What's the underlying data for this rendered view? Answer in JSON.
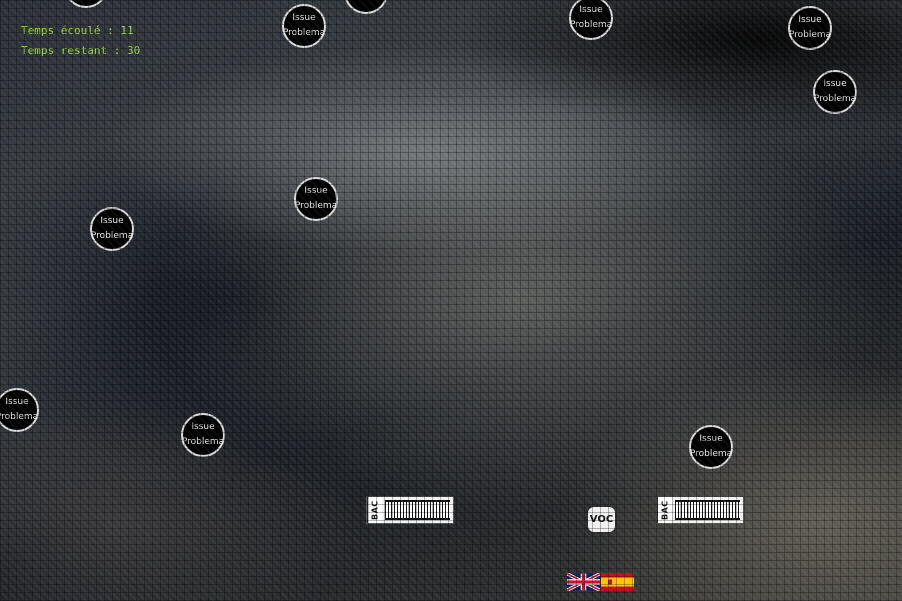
{
  "hud": {
    "elapsed": "Temps écoulé : 11",
    "remaining": "Temps restant : 30"
  },
  "bubbles": [
    {
      "line1": "Issue",
      "line2": "Problema"
    },
    {
      "line1": "Issue",
      "line2": "Problema"
    },
    {
      "line1": "Issue",
      "line2": "Problema"
    },
    {
      "line1": "Issue",
      "line2": "Problema"
    },
    {
      "line1": "Issue",
      "line2": "Problema"
    },
    {
      "line1": "Issue",
      "line2": "Problema"
    },
    {
      "line1": "Issue",
      "line2": "Problema"
    },
    {
      "line1": "Issue",
      "line2": "Problema"
    },
    {
      "line1": "Issue",
      "line2": "Problema"
    }
  ],
  "badges": {
    "left_label": "BAC",
    "right_label": "BAC"
  },
  "voc_label": "VOC",
  "colors": {
    "hud_text": "#9bd84a",
    "bubble_fill": "#000000",
    "bubble_border": "#d9d9d9"
  }
}
